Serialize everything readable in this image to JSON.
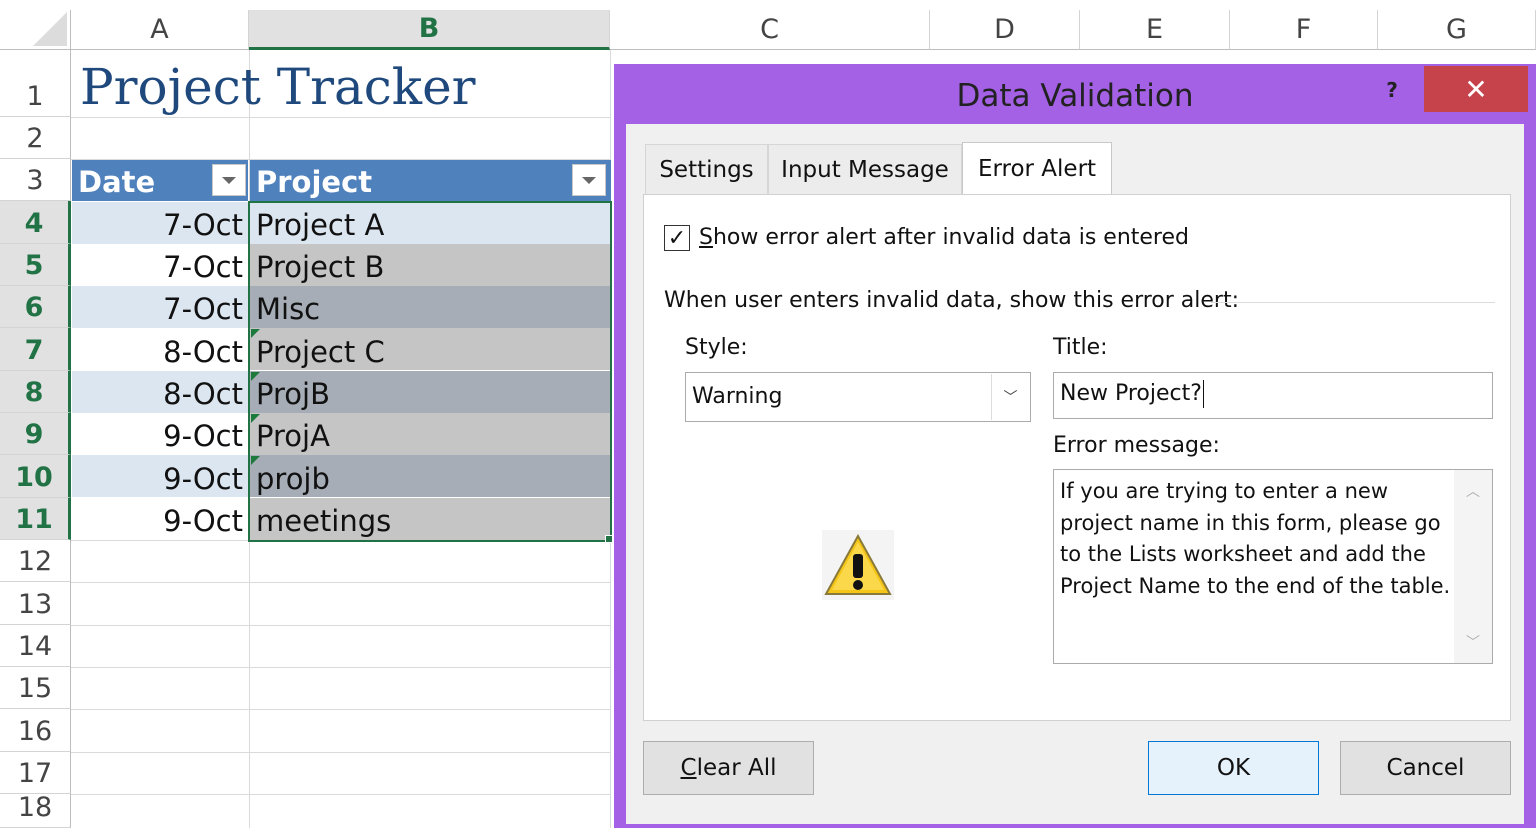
{
  "columns": [
    "A",
    "B",
    "C",
    "D",
    "E",
    "F",
    "G"
  ],
  "selected_column": "B",
  "rows": [
    "1",
    "2",
    "3",
    "4",
    "5",
    "6",
    "7",
    "8",
    "9",
    "10",
    "11",
    "12",
    "13",
    "14",
    "15",
    "16",
    "17",
    "18"
  ],
  "sheet": {
    "title": "Project Tracker",
    "table_headers": [
      "Date",
      "Project"
    ],
    "table_rows": [
      {
        "date": "7-Oct",
        "project": "Project A"
      },
      {
        "date": "7-Oct",
        "project": "Project B"
      },
      {
        "date": "7-Oct",
        "project": "Misc"
      },
      {
        "date": "8-Oct",
        "project": "Project C"
      },
      {
        "date": "8-Oct",
        "project": "ProjB"
      },
      {
        "date": "9-Oct",
        "project": "ProjA"
      },
      {
        "date": "9-Oct",
        "project": "projb"
      },
      {
        "date": "9-Oct",
        "project": "meetings"
      }
    ]
  },
  "dialog": {
    "title": "Data Validation",
    "help": "?",
    "close": "✕",
    "tabs": [
      "Settings",
      "Input Message",
      "Error Alert"
    ],
    "active_tab": "Error Alert",
    "show_alert_checked": true,
    "show_alert_label": "Show error alert after invalid data is entered",
    "section_label": "When user enters invalid data, show this error alert:",
    "style_label": "Style:",
    "style_value": "Warning",
    "title_label": "Title:",
    "title_value": "New Project?",
    "message_label": "Error message:",
    "message_value": "If you are trying to enter a new project name in this form, please go to the Lists worksheet and add the Project Name to the end of the table.",
    "buttons": {
      "clear_all": "Clear All",
      "ok": "OK",
      "cancel": "Cancel"
    },
    "colors": {
      "frame": "#a461e6",
      "close": "#c7434c",
      "table_header": "#4f81bd",
      "accent": "#217346"
    }
  }
}
